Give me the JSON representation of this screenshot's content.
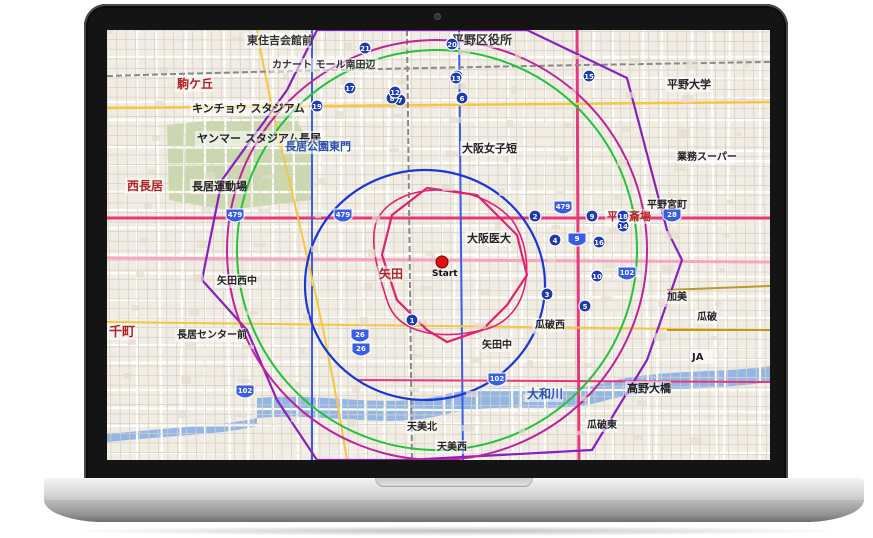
{
  "map": {
    "start_label": "Start",
    "place_labels": [
      {
        "text": "東住吉会館前",
        "color": "#333333",
        "size": 11
      },
      {
        "text": "平野区役所",
        "color": "#333333",
        "size": 12
      },
      {
        "text": "カナート モール南田辺",
        "color": "#333333",
        "size": 10
      },
      {
        "text": "駒ケ丘",
        "color": "#b32020",
        "size": 12
      },
      {
        "text": "キンチョウ スタジアム",
        "color": "#222222",
        "size": 11
      },
      {
        "text": "ヤンマー スタジアム長居",
        "color": "#222222",
        "size": 11
      },
      {
        "text": "長居公園東門",
        "color": "#2a4fb0",
        "size": 11
      },
      {
        "text": "長居運動場",
        "color": "#222222",
        "size": 11
      },
      {
        "text": "西長居",
        "color": "#b32020",
        "size": 12
      },
      {
        "text": "矢田",
        "color": "#b32020",
        "size": 12
      },
      {
        "text": "大阪女子短",
        "color": "#222222",
        "size": 11
      },
      {
        "text": "大阪医大",
        "color": "#222222",
        "size": 11
      },
      {
        "text": "矢田中",
        "color": "#222222",
        "size": 10
      },
      {
        "text": "大和川",
        "color": "#2a4fb0",
        "size": 12
      },
      {
        "text": "高野大橋",
        "color": "#222222",
        "size": 11
      },
      {
        "text": "平野大学",
        "color": "#222222",
        "size": 11
      },
      {
        "text": "業務スーパー",
        "color": "#222222",
        "size": 10
      },
      {
        "text": "平野斎場",
        "color": "#b32020",
        "size": 11
      },
      {
        "text": "JA",
        "color": "#222222",
        "size": 10
      },
      {
        "text": "長居センター前",
        "color": "#222222",
        "size": 10
      },
      {
        "text": "矢田西中",
        "color": "#222222",
        "size": 10
      },
      {
        "text": "瓜破西",
        "color": "#222222",
        "size": 10
      },
      {
        "text": "天美北",
        "color": "#222222",
        "size": 10
      },
      {
        "text": "天美西",
        "color": "#222222",
        "size": 10
      },
      {
        "text": "瓜破東",
        "color": "#222222",
        "size": 10
      },
      {
        "text": "平野宮町",
        "color": "#222222",
        "size": 10
      },
      {
        "text": "加美",
        "color": "#222222",
        "size": 10
      },
      {
        "text": "瓜破",
        "color": "#222222",
        "size": 10
      },
      {
        "text": "千町",
        "color": "#b32020",
        "size": 13
      }
    ],
    "route_badges": [
      "479",
      "479",
      "479",
      "28",
      "26",
      "26",
      "102",
      "102",
      "102",
      "9"
    ],
    "station_numbers": [
      "1",
      "2",
      "3",
      "4",
      "5",
      "6",
      "7",
      "8",
      "9",
      "10",
      "11",
      "12",
      "13",
      "14",
      "15",
      "16",
      "17",
      "18",
      "19",
      "20",
      "21"
    ],
    "colors": {
      "ring_red": "#e5206e",
      "ring_pink": "#c0219e",
      "ring_blue": "#1a35d8",
      "ring_green": "#23c23a",
      "ring_purple": "#8a1fc0",
      "start_dot": "#e01010",
      "road_main": "#e8377a",
      "road_blue": "#3a5de6",
      "park": "#c8d7b0",
      "river": "#8fb4e8",
      "station": "#1d3ab3"
    }
  }
}
